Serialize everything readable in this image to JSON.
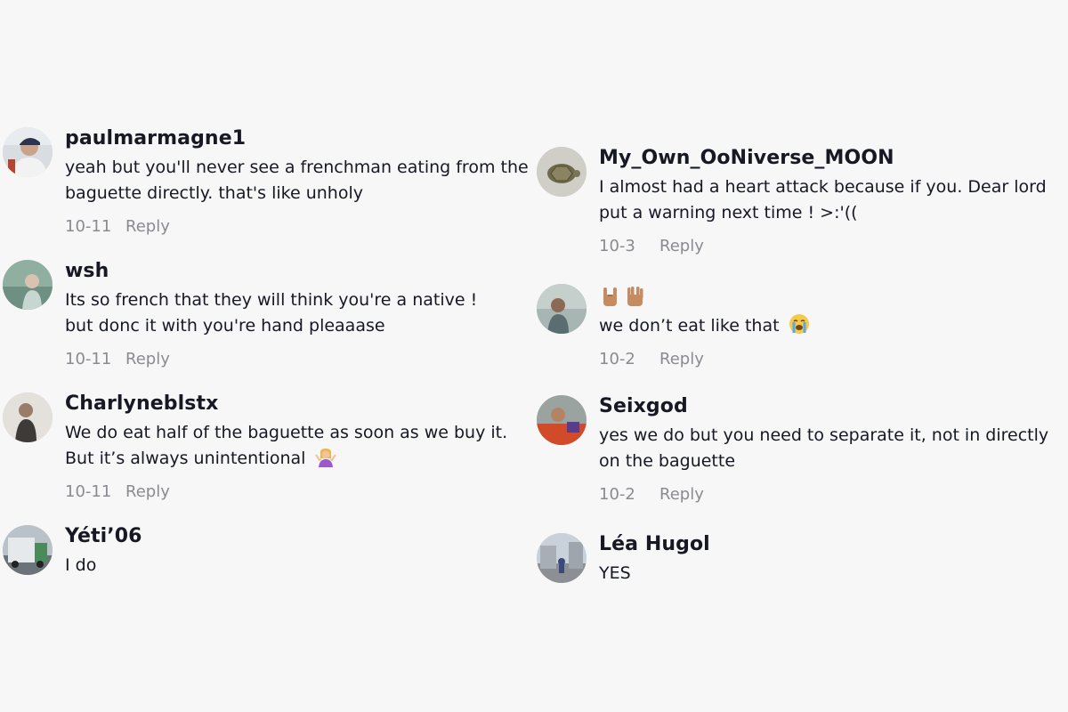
{
  "reply_label": "Reply",
  "left_comments": [
    {
      "username": "paulmarmagne1",
      "lines": [
        "yeah but you'll never see a frenchman eating from the",
        "baguette directly. that's like unholy"
      ],
      "date": "10-11",
      "avatar_icon": "person-photo"
    },
    {
      "username": "wsh",
      "lines": [
        "Its so french that they will think you're a native !",
        "but donc it with you're hand pleaaase"
      ],
      "date": "10-11",
      "avatar_icon": "person-photo"
    },
    {
      "username": "Charlyneblstx",
      "lines": [
        "We do eat half of the baguette as soon as we buy it.",
        "But it’s always unintentional"
      ],
      "line_emoji": "woman-shrugging-emoji",
      "date": "10-11",
      "avatar_icon": "person-photo"
    },
    {
      "username": "Yéti’06",
      "lines": [
        "I do"
      ],
      "avatar_icon": "truck-photo"
    }
  ],
  "right_comments": [
    {
      "username": "My_Own_OoNiverse_MOON",
      "lines": [
        "I almost had a heart attack because if you. Dear lord",
        "put a warning next time ! >:'(("
      ],
      "date": "10-3",
      "avatar_icon": "turtle-photo"
    },
    {
      "username_emojis": [
        "rock-on-hand-emoji",
        "vulcan-salute-emoji"
      ],
      "lines": [
        "we don’t eat like that"
      ],
      "line_emoji": "crying-face-emoji",
      "date": "10-2",
      "avatar_icon": "person-photo"
    },
    {
      "username": "Seixgod",
      "lines": [
        "yes we do but you need to separate it, not in directly",
        "on the baguette"
      ],
      "date": "10-2",
      "avatar_icon": "person-photo"
    },
    {
      "username": "Léa Hugol",
      "lines": [
        "YES"
      ],
      "avatar_icon": "building-photo"
    }
  ]
}
